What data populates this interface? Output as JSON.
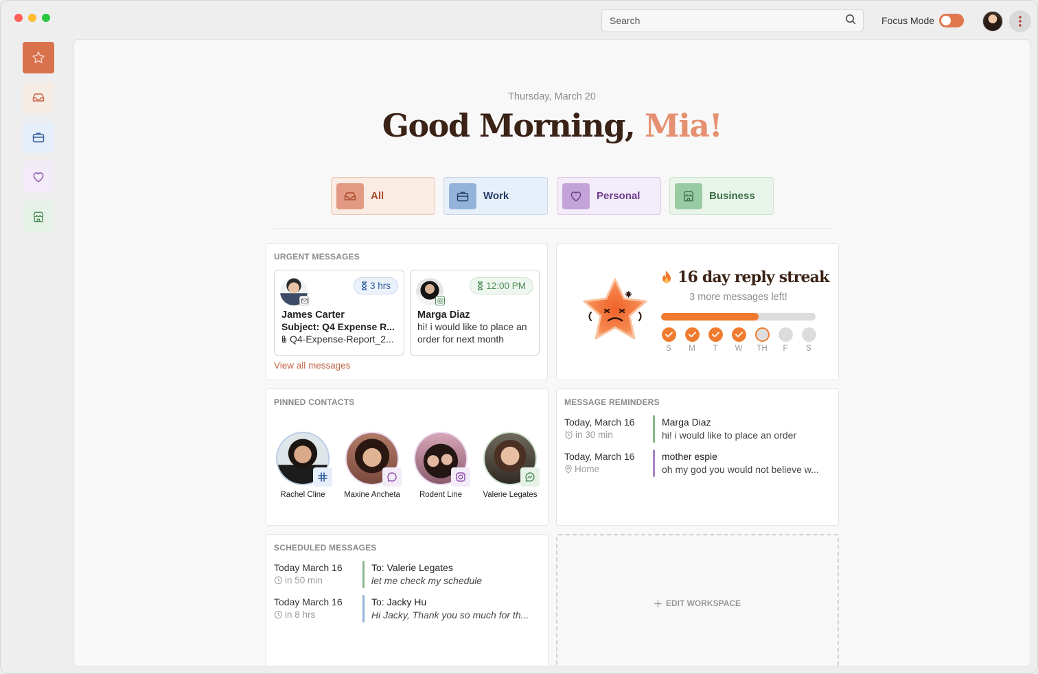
{
  "window": {
    "traffic_lights": [
      "close",
      "minimize",
      "maximize"
    ]
  },
  "topbar": {
    "search_placeholder": "Search",
    "focus_mode_label": "Focus Mode",
    "focus_mode_on": true
  },
  "sidebar": {
    "items": [
      {
        "name": "favorites",
        "icon": "star-icon",
        "color": "#c9623e",
        "bg": "#d9724c",
        "active": true
      },
      {
        "name": "all",
        "icon": "inbox-icon",
        "color": "#c9623e",
        "bg": "#f6ece6"
      },
      {
        "name": "work",
        "icon": "briefcase-icon",
        "color": "#2f5b99",
        "bg": "#e5eef9"
      },
      {
        "name": "personal",
        "icon": "heart-icon",
        "color": "#8a4fa8",
        "bg": "#f3ebf8"
      },
      {
        "name": "business",
        "icon": "store-icon",
        "color": "#4c8a55",
        "bg": "#e6f2e7"
      }
    ]
  },
  "header": {
    "date": "Thursday, March 20",
    "greeting": "Good Morning, ",
    "name": "Mia!"
  },
  "filters": [
    {
      "label": "All",
      "icon": "inbox-icon",
      "color": "#a8492c",
      "bg": "#faece3",
      "border": "#e6c9b8",
      "icon_bg": "#e29a82"
    },
    {
      "label": "Work",
      "icon": "briefcase-icon",
      "color": "#1f3a66",
      "bg": "#e7f0fa",
      "border": "#c7d7ea",
      "icon_bg": "#95b3d9"
    },
    {
      "label": "Personal",
      "icon": "heart-icon",
      "color": "#6d3a8a",
      "bg": "#f3ecf9",
      "border": "#dcccea",
      "icon_bg": "#c3a3d8"
    },
    {
      "label": "Business",
      "icon": "store-icon",
      "color": "#3b6e44",
      "bg": "#e9f5ea",
      "border": "#cfe3d1",
      "icon_bg": "#99cba2"
    }
  ],
  "urgent": {
    "title": "URGENT MESSAGES",
    "messages": [
      {
        "name": "James Carter",
        "line1": "Subject: Q4 Expense R...",
        "line2": "Q4-Expense-Report_2...",
        "time": "3 hrs",
        "time_color": "#2f5b99",
        "pill_bg": "#eaf1fa",
        "pill_border": "#c8d8ec",
        "app_icon": "outlook-icon"
      },
      {
        "name": "Marga Diaz",
        "line1": "hi! i would like to place an",
        "line2": "order for next month",
        "time": "12:00 PM",
        "time_color": "#4c8a55",
        "pill_bg": "#eef7ef",
        "pill_border": "#cfe3d1",
        "app_icon": "instagram-icon"
      }
    ],
    "view_all": "View all messages"
  },
  "streak": {
    "title": "16 day reply streak",
    "subtitle": "3 more messages left!",
    "progress": 0.63,
    "days": [
      {
        "label": "S",
        "state": "done"
      },
      {
        "label": "M",
        "state": "done"
      },
      {
        "label": "T",
        "state": "done"
      },
      {
        "label": "W",
        "state": "done"
      },
      {
        "label": "TH",
        "state": "today"
      },
      {
        "label": "F",
        "state": "todo"
      },
      {
        "label": "S",
        "state": "todo"
      }
    ]
  },
  "pinned": {
    "title": "PINNED CONTACTS",
    "contacts": [
      {
        "name": "Rachel Cline",
        "platform": "slack-icon",
        "ring": "#b9cde6",
        "plat_bg": "#e5eef9",
        "plat_color": "#2f5b99"
      },
      {
        "name": "Maxine Ancheta",
        "platform": "chat-bubble-icon",
        "ring": "#e7d6ee",
        "plat_bg": "#f3ebf8",
        "plat_color": "#8a4fa8"
      },
      {
        "name": "Rodent Line",
        "platform": "instagram-icon",
        "ring": "#e7d6ee",
        "plat_bg": "#f3ebf8",
        "plat_color": "#8a4fa8"
      },
      {
        "name": "Valerie Legates",
        "platform": "messenger-icon",
        "ring": "#cfe3d1",
        "plat_bg": "#e6f2e7",
        "plat_color": "#4c8a55"
      }
    ]
  },
  "reminders": {
    "title": "MESSAGE REMINDERS",
    "items": [
      {
        "date": "Today, March 16",
        "sub": "in 30 min",
        "sub_icon": "alarm-icon",
        "who": "Marga Diaz",
        "msg": "hi! i would like to place an order",
        "bar": "#8ab78f"
      },
      {
        "date": "Today, March 16",
        "sub": "Home",
        "sub_icon": "location-pin-icon",
        "who": "mother espie",
        "msg": "oh my god you would not believe w...",
        "bar": "#a784c2"
      }
    ]
  },
  "scheduled": {
    "title": "SCHEDULED MESSAGES",
    "items": [
      {
        "date": "Today March 16",
        "sub": "in 50 min",
        "to": "To: Valerie Legates",
        "msg": "let me check my schedule",
        "bar": "#8ab78f"
      },
      {
        "date": "Today March 16",
        "sub": "in 8 hrs",
        "to": "To: Jacky Hu",
        "msg": "Hi Jacky, Thank you so much for th...",
        "bar": "#95b3d9"
      }
    ]
  },
  "workspace": {
    "edit_label": "EDIT WORKSPACE"
  }
}
